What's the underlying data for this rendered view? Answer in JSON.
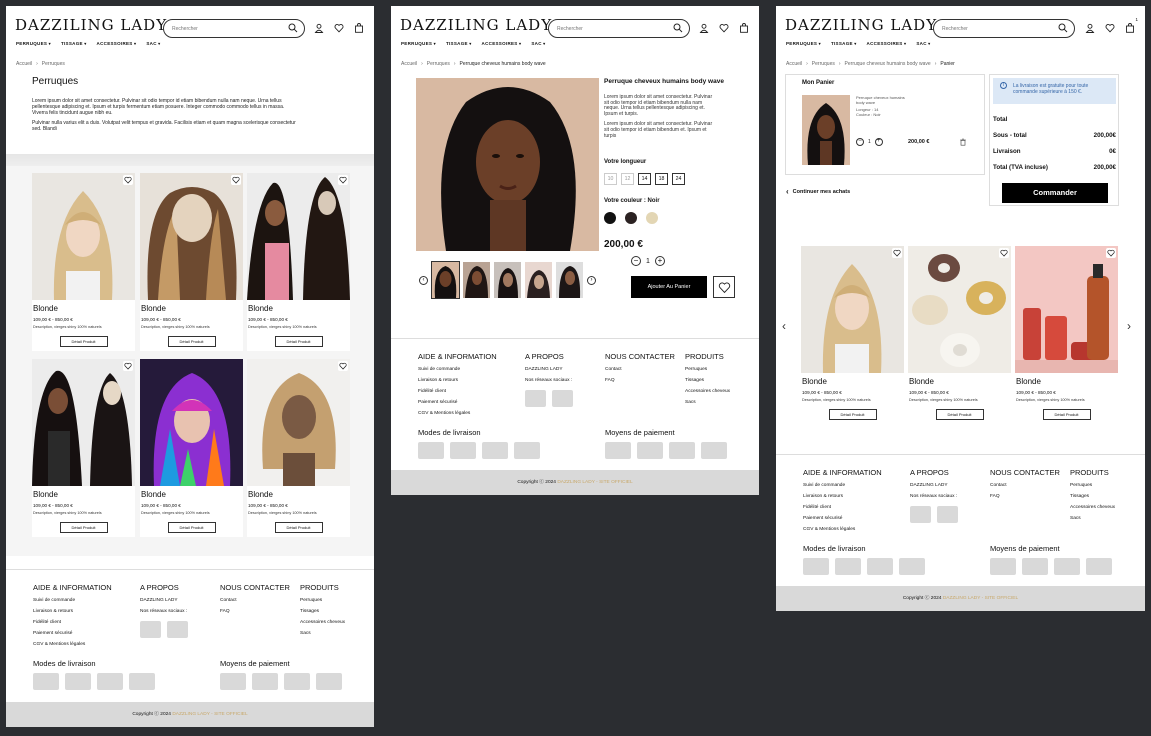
{
  "brand": {
    "logo": "DAZZILING LADY"
  },
  "search": {
    "placeholder": "Rechercher"
  },
  "nav": [
    "PERRUQUES",
    "TISSAGE",
    "ACCESSOIRES",
    "SAC"
  ],
  "cart_count": "1",
  "icons": [
    "user-icon",
    "heart-icon",
    "bag-icon",
    "search-icon",
    "trash-icon",
    "info-icon"
  ],
  "colors": {
    "accent": "#c8a86a",
    "notice_bg": "#dce8f6",
    "notice_text": "#3566a8",
    "button": "#000000"
  },
  "list_page": {
    "breadcrumb": [
      "Accueil",
      "Perruques"
    ],
    "title": "Perruques",
    "desc1": "Lorem ipsum dolor sit amet consectetur. Pulvinar sit odio tempor id etiam bibendum nulla nam neque. Urna tellus pellentesque adipiscing et. Ipsum et turpis fermentum etiam posuere. Integer commodo commodo tellus in massa. Viverra felis tincidunt augue nibh eu.",
    "desc2": "Pulvinar nulla varius elit a duis. Volutpat velit tempus et gravida. Facilisis etiam et quam magna scelerisque consectetur sed. Blandi",
    "products": [
      {
        "name": "Blonde",
        "price": "109,00 € - 850,00 €",
        "desc": "Description, vierges shiny 100% naturels",
        "button": "Détail Produit"
      },
      {
        "name": "Blonde",
        "price": "109,00 € - 850,00 €",
        "desc": "Description, vierges shiny 100% naturels",
        "button": "Détail Produit"
      },
      {
        "name": "Blonde",
        "price": "109,00 € - 850,00 €",
        "desc": "Description, vierges shiny 100% naturels",
        "button": "Détail Produit"
      },
      {
        "name": "Blonde",
        "price": "109,00 € - 850,00 €",
        "desc": "Description, vierges shiny 100% naturels",
        "button": "Détail Produit"
      },
      {
        "name": "Blonde",
        "price": "109,00 € - 850,00 €",
        "desc": "Description, vierges shiny 100% naturels",
        "button": "Détail Produit"
      },
      {
        "name": "Blonde",
        "price": "109,00 € - 850,00 €",
        "desc": "Description, vierges shiny 100% naturels",
        "button": "Détail Produit"
      }
    ]
  },
  "product_page": {
    "breadcrumb": [
      "Accueil",
      "Perruques",
      "Perruque cheveux humains body wave"
    ],
    "name": "Perruque cheveux humains body wave",
    "desc1": "Lorem ipsum dolor sit amet consectetur. Pulvinar sit odio tempor id etiam bibendum nulla nam neque. Urna tellus pellentesque adipiscing et. Ipsum et turpis.",
    "desc2": "Lorem ipsum dolor sit amet consectetur. Pulvinar sit odio tempor id etiam bibendum et. Ipsum et turpis",
    "length_label": "Votre longueur",
    "lengths": [
      "10",
      "12",
      "14",
      "18",
      "24"
    ],
    "color_label": "Votre couleur : Noir",
    "swatches": [
      "#111111",
      "#2b2222",
      "#e3d6b4"
    ],
    "price": "200,00 €",
    "qty": "1",
    "add_button": "Ajouter Au Panier"
  },
  "cart_page": {
    "breadcrumb": [
      "Accueil",
      "Perruques",
      "Perruque cheveux humains body wave",
      "Panier"
    ],
    "title": "Mon Panier",
    "item": {
      "name": "Perruque cheveux humains body wave",
      "length": "Longeur : 14",
      "color": "Couleur : Noir",
      "qty": "1",
      "price": "200,00 €"
    },
    "notice": "La livraison est gratuite pour toute commande supérieure à 150 €.",
    "summary": [
      {
        "label": "Total",
        "value": ""
      },
      {
        "label": "Sous - total",
        "value": "200,00€"
      },
      {
        "label": "Livraison",
        "value": "0€"
      },
      {
        "label": "Total (TVA incluse)",
        "value": "200,00€"
      }
    ],
    "order_button": "Commander",
    "continue": "Continuer mes achats",
    "products": [
      {
        "name": "Blonde",
        "price": "109,00 € - 850,00 €",
        "desc": "Description, vierges shiny 100% naturels",
        "button": "Détail Produit"
      },
      {
        "name": "Blonde",
        "price": "109,00 € - 850,00 €",
        "desc": "Description, vierges shiny 100% naturels",
        "button": "Détail Produit"
      },
      {
        "name": "Blonde",
        "price": "109,00 € - 850,00 €",
        "desc": "Description, vierges shiny 100% naturels",
        "button": "Détail Produit"
      }
    ]
  },
  "footer": {
    "aide_title": "AIDE & INFORMATION",
    "aide_links": [
      "Suivi de commande",
      "Livraison & retours",
      "Fidélité client",
      "Paiement sécurisé",
      "CGV  & Mentions légales"
    ],
    "apropos_title": "A PROPOS",
    "apropos_links": [
      "DAZZLING LADY",
      "Nos réseaux sociaux :"
    ],
    "contact_title": "NOUS CONTACTER",
    "contact_links": [
      "Contact",
      "FAQ"
    ],
    "produits_title": "PRODUITS",
    "produits_links": [
      "Perruques",
      "Tissages",
      "Accessoires cheveux",
      "Sacs"
    ],
    "livraison_title": "Modes de livraison",
    "paiement_title": "Moyens de paiement",
    "copyright": "Copyright ⓒ 2024",
    "copyright_brand": "DAZZLING LADY - SITE OFFICIEL"
  }
}
